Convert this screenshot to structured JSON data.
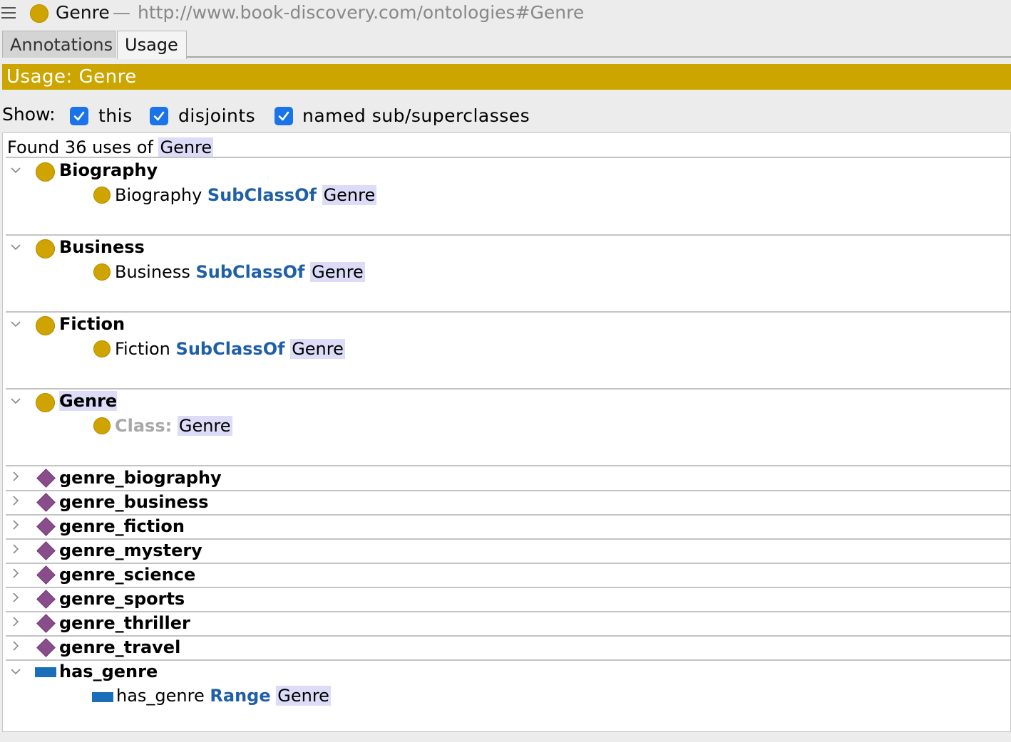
{
  "titlebar": {
    "entity": "Genre",
    "separator": "—",
    "iri": "http://www.book-discovery.com/ontologies#Genre"
  },
  "tabs": [
    {
      "label": "Annotations",
      "active": false
    },
    {
      "label": "Usage",
      "active": true
    }
  ],
  "usage_header": "Usage: Genre",
  "show": {
    "label": "Show:",
    "options": [
      {
        "label": "this",
        "checked": true
      },
      {
        "label": "disjoints",
        "checked": true
      },
      {
        "label": "named sub/superclasses",
        "checked": true
      }
    ]
  },
  "found": {
    "prefix": "Found 36 uses of",
    "entity": "Genre"
  },
  "groups": [
    {
      "name": "Biography",
      "kind": "class",
      "expanded": true,
      "axiom": {
        "subject": "Biography",
        "keyword": "SubClassOf",
        "object": "Genre"
      }
    },
    {
      "name": "Business",
      "kind": "class",
      "expanded": true,
      "axiom": {
        "subject": "Business",
        "keyword": "SubClassOf",
        "object": "Genre"
      }
    },
    {
      "name": "Fiction",
      "kind": "class",
      "expanded": true,
      "axiom": {
        "subject": "Fiction",
        "keyword": "SubClassOf",
        "object": "Genre"
      }
    },
    {
      "name": "Genre",
      "kind": "class",
      "expanded": true,
      "axiom": {
        "keyword": "Class:",
        "object": "Genre"
      }
    },
    {
      "name": "genre_biography",
      "kind": "individual",
      "expanded": false
    },
    {
      "name": "genre_business",
      "kind": "individual",
      "expanded": false
    },
    {
      "name": "genre_fiction",
      "kind": "individual",
      "expanded": false
    },
    {
      "name": "genre_mystery",
      "kind": "individual",
      "expanded": false
    },
    {
      "name": "genre_science",
      "kind": "individual",
      "expanded": false
    },
    {
      "name": "genre_sports",
      "kind": "individual",
      "expanded": false
    },
    {
      "name": "genre_thriller",
      "kind": "individual",
      "expanded": false
    },
    {
      "name": "genre_travel",
      "kind": "individual",
      "expanded": false
    },
    {
      "name": "has_genre",
      "kind": "object-property",
      "expanded": true,
      "axiom": {
        "subject": "has_genre",
        "keyword": "Range",
        "object": "Genre"
      }
    }
  ],
  "colors": {
    "class": "#d0a400",
    "individual": "#8a4d8c",
    "property": "#1a6fb8",
    "keyword": "#1e5fa8",
    "header_band": "#cda500",
    "highlight": "#dcdcf8",
    "checkbox": "#1a73e8"
  }
}
